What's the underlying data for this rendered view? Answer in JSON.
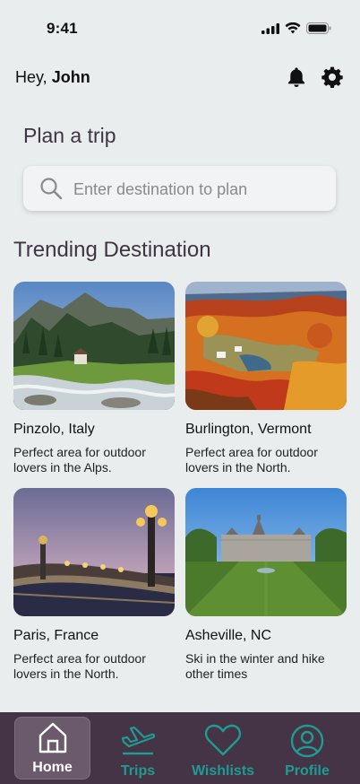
{
  "status_bar": {
    "time": "9:41"
  },
  "header": {
    "greeting_prefix": "Hey, ",
    "user_name": "John"
  },
  "plan": {
    "title": "Plan a trip",
    "search_placeholder": "Enter destination to plan"
  },
  "trending": {
    "title": "Trending Destination",
    "destinations": [
      {
        "name": "Pinzolo, Italy",
        "description": "Perfect area for outdoor lovers in the Alps."
      },
      {
        "name": "Burlington, Vermont",
        "description": "Perfect area for outdoor lovers in the North."
      },
      {
        "name": "Paris, France",
        "description": "Perfect area for outdoor lovers in the North."
      },
      {
        "name": "Asheville, NC",
        "description": "Ski in the winter and hike other times"
      }
    ]
  },
  "tab_bar": {
    "items": [
      {
        "label": "Home",
        "icon": "home-icon",
        "active": true
      },
      {
        "label": "Trips",
        "icon": "airplane-icon",
        "active": false
      },
      {
        "label": "Wishlists",
        "icon": "heart-icon",
        "active": false
      },
      {
        "label": "Profile",
        "icon": "person-icon",
        "active": false
      }
    ]
  },
  "colors": {
    "background": "#e9edee",
    "heading": "#3f3442",
    "tab_bar": "#453445",
    "tab_accent": "#1e9b93",
    "tab_active_bg": "#6a5a6c"
  }
}
